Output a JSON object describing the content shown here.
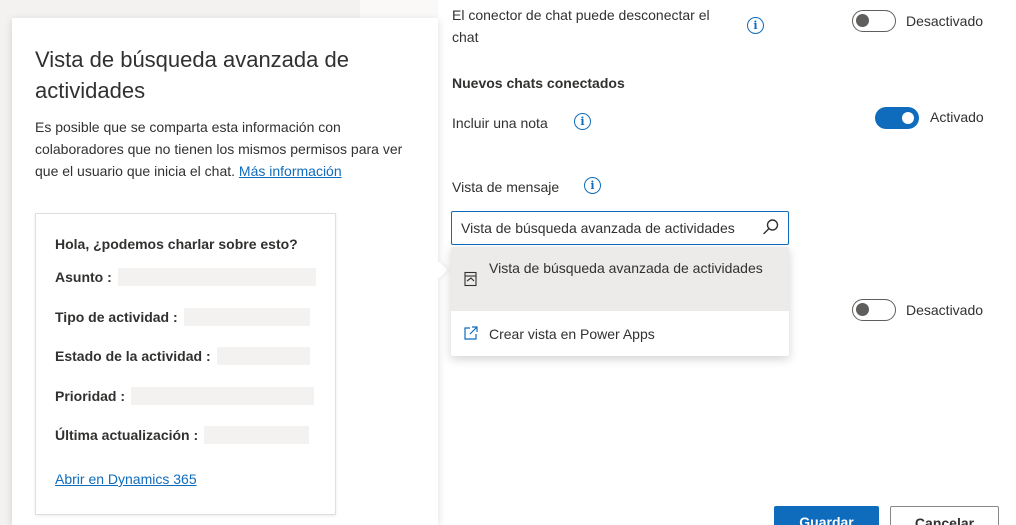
{
  "callout": {
    "title": "Vista de búsqueda avanzada de actividades",
    "description": "Es posible que se comparta esta información con colaboradores que no tienen los mismos permisos para ver que el usuario que inicia el chat.",
    "more_info_link": "Más información",
    "preview": {
      "heading": "Hola, ¿podemos charlar sobre esto?",
      "fields": [
        {
          "label": "Asunto :"
        },
        {
          "label": "Tipo de actividad :"
        },
        {
          "label": "Estado de la actividad :"
        },
        {
          "label": "Prioridad :"
        },
        {
          "label": "Última actualización :"
        }
      ],
      "open_link": "Abrir en Dynamics 365"
    }
  },
  "settings": {
    "disconnect": {
      "label": "El conector de chat puede desconectar el chat",
      "state_text": "Desactivado",
      "state": false
    },
    "new_chats_header": "Nuevos chats conectados",
    "include_note": {
      "label": "Incluir una nota",
      "state_text": "Activado",
      "state": true
    },
    "message_view": {
      "label": "Vista de mensaje",
      "search_value": "Vista de búsqueda avanzada de actividades",
      "options": [
        {
          "label": "Vista de búsqueda avanzada de actividades",
          "icon": "view-icon",
          "selected": true
        },
        {
          "label": "Crear vista en Power Apps",
          "icon": "external-link-icon",
          "selected": false
        }
      ]
    },
    "extra_toggle": {
      "state_text": "Desactivado",
      "state": false
    }
  },
  "footer": {
    "save_label": "Guardar",
    "cancel_label": "Cancelar"
  },
  "colors": {
    "accent": "#0f6cbd",
    "background_left": "#f3f2f1"
  }
}
